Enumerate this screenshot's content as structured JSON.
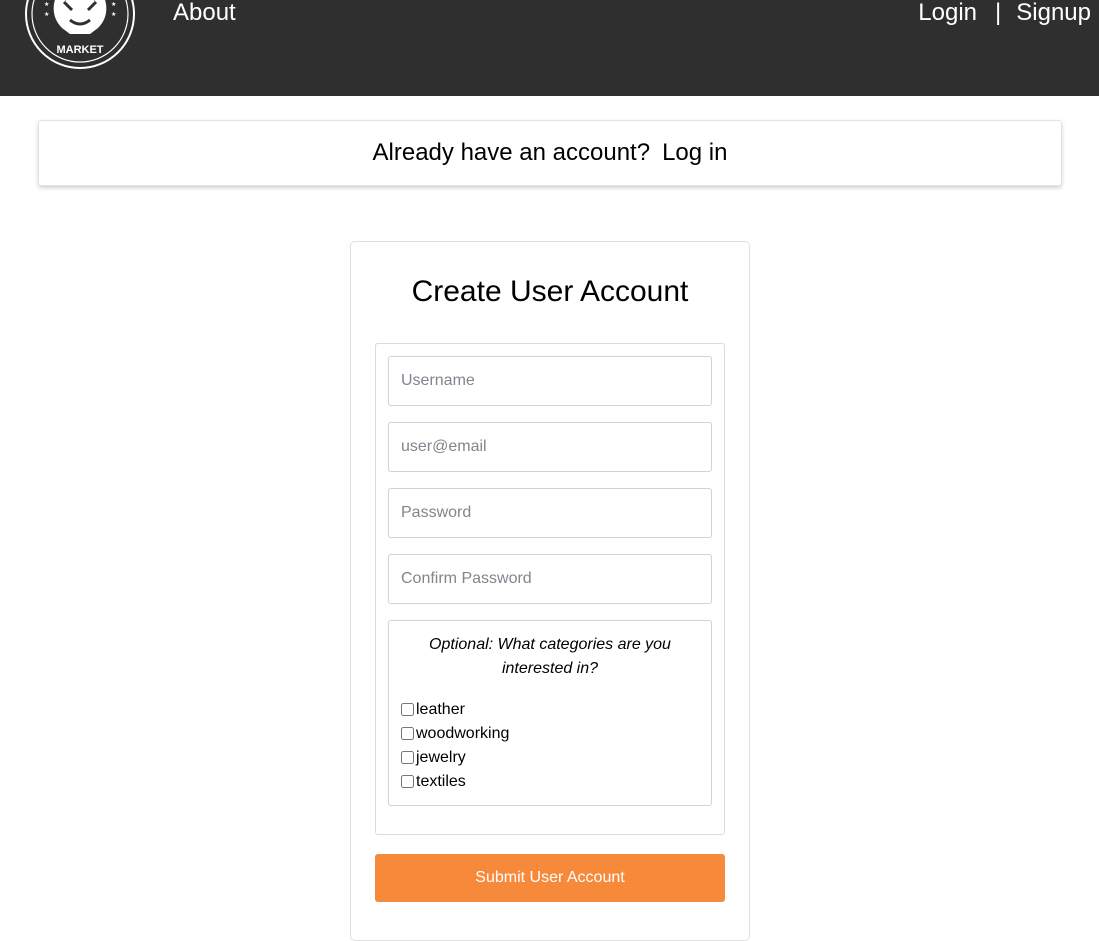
{
  "nav": {
    "logo_text": "MARKET",
    "about": "About",
    "login": "Login",
    "separator": "|",
    "signup": "Signup"
  },
  "banner": {
    "question": "Already have an account?",
    "login_link": "Log in"
  },
  "form": {
    "title": "Create User Account",
    "username_placeholder": "Username",
    "email_placeholder": "user@email",
    "password_placeholder": "Password",
    "confirm_placeholder": "Confirm Password",
    "categories_question": "Optional: What categories are you interested in?",
    "categories": [
      {
        "label": "leather",
        "checked": false
      },
      {
        "label": "woodworking",
        "checked": false
      },
      {
        "label": "jewelry",
        "checked": false
      },
      {
        "label": "textiles",
        "checked": false
      }
    ],
    "submit_label": "Submit User Account"
  },
  "colors": {
    "navbar_bg": "#2f2f2f",
    "submit_bg": "#f68a3a"
  }
}
